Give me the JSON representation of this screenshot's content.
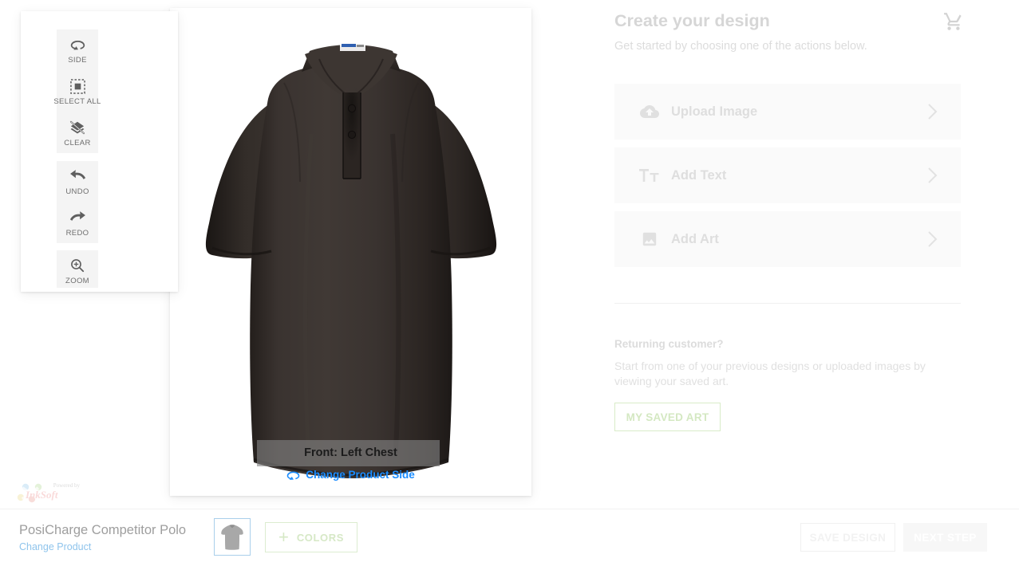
{
  "tool_panel": {
    "groups": [
      {
        "buttons": [
          {
            "label": "SIDE",
            "icon": "rotate-side-icon"
          },
          {
            "label": "SELECT ALL",
            "icon": "select-all-icon"
          },
          {
            "label": "CLEAR",
            "icon": "clear-layers-icon"
          }
        ]
      },
      {
        "buttons": [
          {
            "label": "UNDO",
            "icon": "undo-arrow-icon"
          },
          {
            "label": "REDO",
            "icon": "redo-arrow-icon"
          }
        ]
      },
      {
        "buttons": [
          {
            "label": "ZOOM",
            "icon": "zoom-in-magnifier-icon"
          }
        ]
      }
    ]
  },
  "canvas": {
    "side_label": "Front: Left Chest",
    "change_side_label": "Change Product Side",
    "change_side_icon": "rotate-side-icon",
    "watermark": {
      "prefix": "Powered by",
      "brand": "InkSoft"
    }
  },
  "right_panel": {
    "title": "Create your design",
    "subtitle": "Get started by choosing one of the actions below.",
    "cart_icon": "shopping-cart-icon",
    "actions": [
      {
        "label": "Upload Image",
        "icon": "cloud-upload-icon",
        "chevron": "chevron-right-icon"
      },
      {
        "label": "Add Text",
        "icon": "text-format-icon",
        "chevron": "chevron-right-icon"
      },
      {
        "label": "Add Art",
        "icon": "image-art-icon",
        "chevron": "chevron-right-icon"
      }
    ],
    "returning": {
      "heading": "Returning customer?",
      "body": "Start from one of your previous designs or uploaded images by viewing your saved art.",
      "button_label": "MY SAVED ART"
    }
  },
  "bottom_bar": {
    "product_name": "PosiCharge Competitor Polo",
    "change_product_label": "Change Product",
    "product_thumb_icon": "polo-shirt-thumbnail",
    "colors_label": "COLORS",
    "colors_plus_icon": "plus-icon",
    "save_design_label": "SAVE DESIGN",
    "next_step_label": "NEXT STEP"
  },
  "colors": {
    "accent_blue": "#1a8cff",
    "link_blue": "#8fc4ec",
    "green_outline": "#d8ecc8",
    "muted_gray": "#dedede",
    "shirt_color": "#2b2724"
  }
}
